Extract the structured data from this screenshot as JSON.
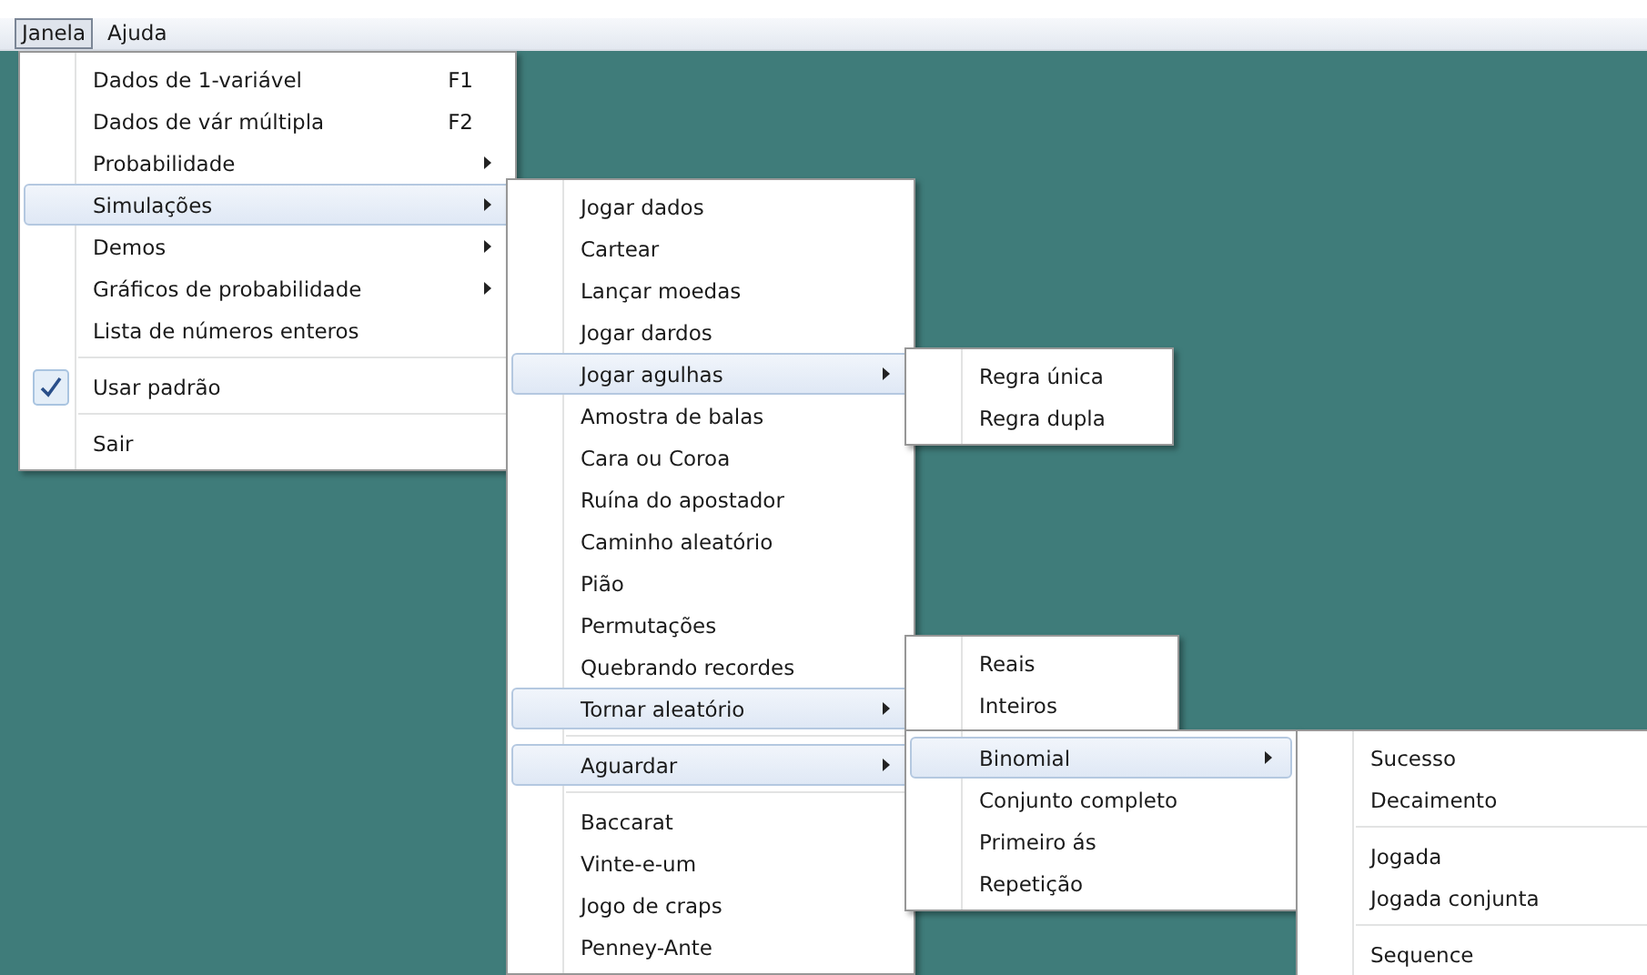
{
  "menubar": [
    {
      "label": "Janela",
      "selected": true
    },
    {
      "label": "Ajuda",
      "selected": false
    }
  ],
  "menus": [
    {
      "items": [
        {
          "kind": "item",
          "label": "Dados de 1-variável",
          "shortcut": "F1",
          "submenu": false,
          "selected": false,
          "checked": false
        },
        {
          "kind": "item",
          "label": "Dados de vár múltipla",
          "shortcut": "F2",
          "submenu": false,
          "selected": false,
          "checked": false
        },
        {
          "kind": "item",
          "label": "Probabilidade",
          "submenu": true,
          "selected": false,
          "checked": false
        },
        {
          "kind": "item",
          "label": "Simulações",
          "submenu": true,
          "selected": true,
          "checked": false
        },
        {
          "kind": "item",
          "label": "Demos",
          "submenu": true,
          "selected": false,
          "checked": false
        },
        {
          "kind": "item",
          "label": "Gráficos de probabilidade",
          "submenu": true,
          "selected": false,
          "checked": false
        },
        {
          "kind": "item",
          "label": "Lista de números enteros",
          "submenu": false,
          "selected": false,
          "checked": false
        },
        {
          "kind": "separator"
        },
        {
          "kind": "item",
          "label": "Usar padrão",
          "submenu": false,
          "selected": false,
          "checked": true
        },
        {
          "kind": "separator"
        },
        {
          "kind": "item",
          "label": "Sair",
          "submenu": false,
          "selected": false,
          "checked": false
        }
      ]
    },
    {
      "items": [
        {
          "kind": "item",
          "label": "Jogar dados",
          "submenu": false,
          "selected": false,
          "checked": false
        },
        {
          "kind": "item",
          "label": "Cartear",
          "submenu": false,
          "selected": false,
          "checked": false
        },
        {
          "kind": "item",
          "label": "Lançar moedas",
          "submenu": false,
          "selected": false,
          "checked": false
        },
        {
          "kind": "item",
          "label": "Jogar dardos",
          "submenu": false,
          "selected": false,
          "checked": false
        },
        {
          "kind": "item",
          "label": "Jogar agulhas",
          "submenu": true,
          "selected": true,
          "checked": false
        },
        {
          "kind": "item",
          "label": "Amostra de balas",
          "submenu": false,
          "selected": false,
          "checked": false
        },
        {
          "kind": "item",
          "label": "Cara ou Coroa",
          "submenu": false,
          "selected": false,
          "checked": false
        },
        {
          "kind": "item",
          "label": "Ruína do apostador",
          "submenu": false,
          "selected": false,
          "checked": false
        },
        {
          "kind": "item",
          "label": "Caminho aleatório",
          "submenu": false,
          "selected": false,
          "checked": false
        },
        {
          "kind": "item",
          "label": "Pião",
          "submenu": false,
          "selected": false,
          "checked": false
        },
        {
          "kind": "item",
          "label": "Permutações",
          "submenu": false,
          "selected": false,
          "checked": false
        },
        {
          "kind": "item",
          "label": "Quebrando recordes",
          "submenu": false,
          "selected": false,
          "checked": false
        },
        {
          "kind": "item",
          "label": "Tornar aleatório",
          "submenu": true,
          "selected": true,
          "checked": false
        },
        {
          "kind": "separator"
        },
        {
          "kind": "item",
          "label": "Aguardar",
          "submenu": true,
          "selected": true,
          "checked": false
        },
        {
          "kind": "separator"
        },
        {
          "kind": "item",
          "label": "Baccarat",
          "submenu": false,
          "selected": false,
          "checked": false
        },
        {
          "kind": "item",
          "label": "Vinte-e-um",
          "submenu": false,
          "selected": false,
          "checked": false
        },
        {
          "kind": "item",
          "label": "Jogo de craps",
          "submenu": false,
          "selected": false,
          "checked": false
        },
        {
          "kind": "item",
          "label": "Penney-Ante",
          "submenu": false,
          "selected": false,
          "checked": false
        }
      ]
    },
    {
      "items": [
        {
          "kind": "item",
          "label": "Regra única",
          "submenu": false,
          "selected": false,
          "checked": false
        },
        {
          "kind": "item",
          "label": "Regra dupla",
          "submenu": false,
          "selected": false,
          "checked": false
        }
      ]
    },
    {
      "items": [
        {
          "kind": "item",
          "label": "Reais",
          "submenu": false,
          "selected": false,
          "checked": false
        },
        {
          "kind": "item",
          "label": "Inteiros",
          "submenu": false,
          "selected": false,
          "checked": false
        }
      ]
    },
    {
      "items": [
        {
          "kind": "item",
          "label": "Binomial",
          "submenu": true,
          "selected": true,
          "checked": false
        },
        {
          "kind": "item",
          "label": "Conjunto completo",
          "submenu": false,
          "selected": false,
          "checked": false
        },
        {
          "kind": "item",
          "label": "Primeiro ás",
          "submenu": false,
          "selected": false,
          "checked": false
        },
        {
          "kind": "item",
          "label": "Repetição",
          "submenu": false,
          "selected": false,
          "checked": false
        }
      ]
    },
    {
      "items": [
        {
          "kind": "item",
          "label": "Sucesso",
          "submenu": false,
          "selected": false,
          "checked": false
        },
        {
          "kind": "item",
          "label": "Decaimento",
          "submenu": false,
          "selected": false,
          "checked": false
        },
        {
          "kind": "separator"
        },
        {
          "kind": "item",
          "label": "Jogada",
          "submenu": false,
          "selected": false,
          "checked": false
        },
        {
          "kind": "item",
          "label": "Jogada conjunta",
          "submenu": false,
          "selected": false,
          "checked": false
        },
        {
          "kind": "separator"
        },
        {
          "kind": "item",
          "label": "Sequence",
          "submenu": false,
          "selected": false,
          "checked": false
        }
      ]
    }
  ]
}
